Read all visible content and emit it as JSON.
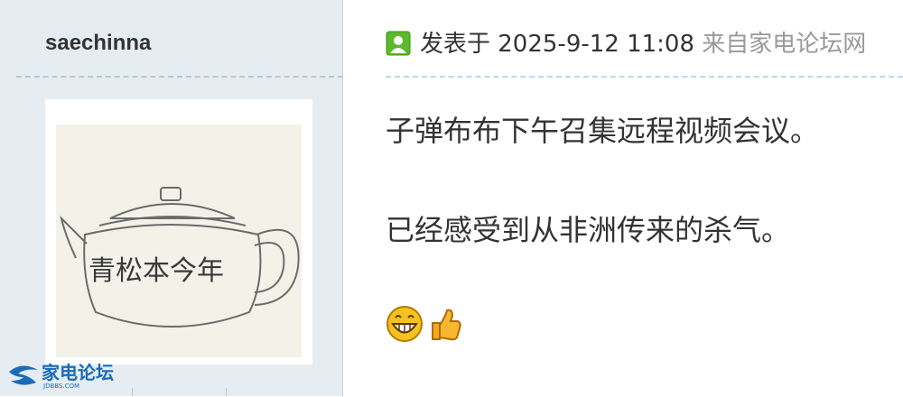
{
  "author": {
    "username": "saechinna",
    "avatar_icon": "teapot-drawing-avatar",
    "avatar_inscription": "青松本今年"
  },
  "post": {
    "meta_prefix": "发表于 2025-9-12 11:08",
    "meta_source": "来自家电论坛网",
    "body_lines": [
      "子弹布布下午召集远程视频会议。",
      "已经感受到从非洲传来的杀气。"
    ],
    "emojis": [
      "grinning-face-icon",
      "thumbs-up-icon"
    ]
  },
  "watermark": {
    "name": "家电论坛",
    "url": "JDBBS.COM"
  },
  "colors": {
    "sidebar_bg": "#e5edf2",
    "border": "#c2d5e3",
    "text": "#333333",
    "muted": "#999999",
    "online_green": "#5cb82c"
  }
}
